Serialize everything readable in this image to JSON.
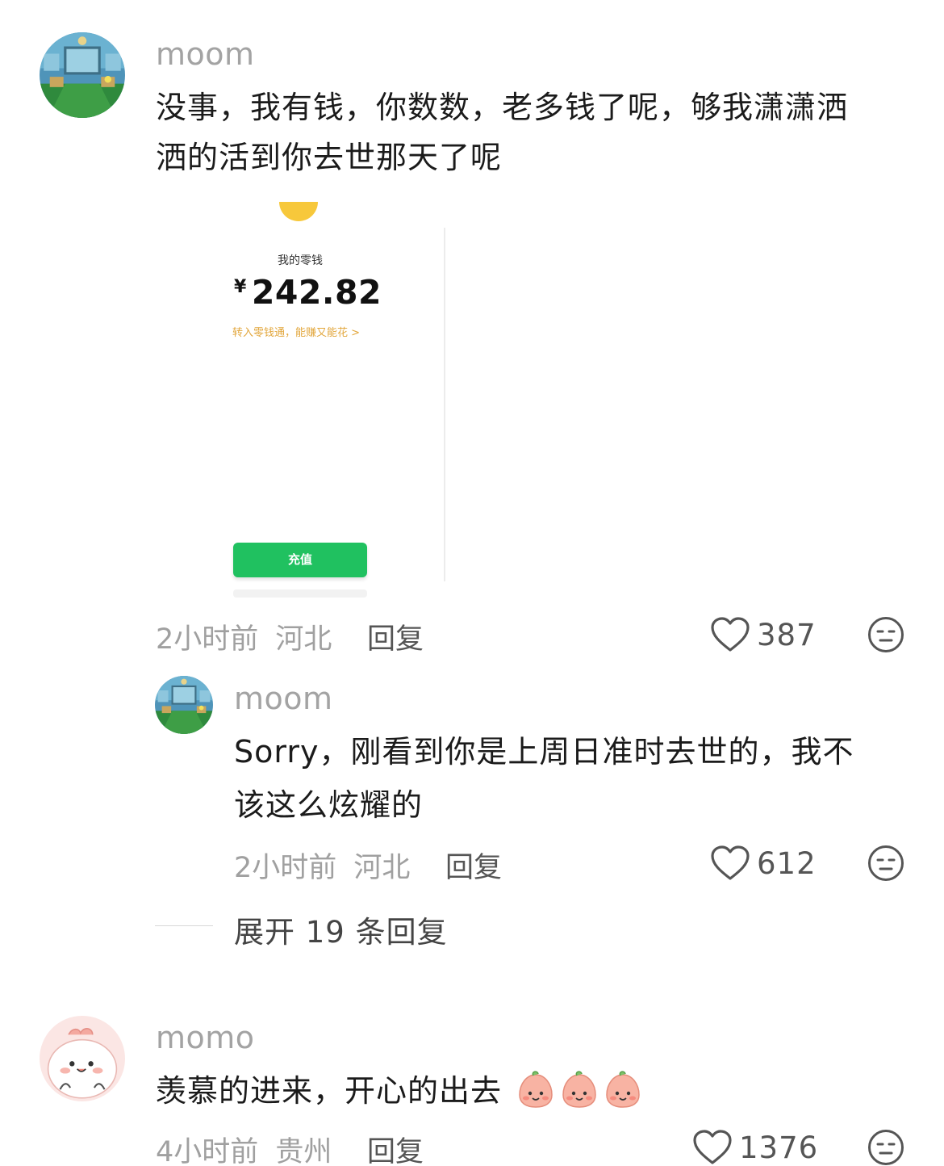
{
  "comments": [
    {
      "username": "moom",
      "text_line1": "没事，我有钱，你数数，老多钱了呢，够我潇潇洒",
      "text_line2": "洒的活到你去世那天了呢",
      "time": "2小时前",
      "location": "河北",
      "reply_label": "回复",
      "likes": "387"
    },
    {
      "username": "moom",
      "text_line1": "Sorry，刚看到你是上周日准时去世的，我不",
      "text_line2": "该这么炫耀的",
      "time": "2小时前",
      "location": "河北",
      "reply_label": "回复",
      "likes": "612"
    },
    {
      "username": "momo",
      "text": "羡慕的进来，开心的出去",
      "time": "4小时前",
      "location": "贵州",
      "reply_label": "回复",
      "likes": "1376"
    }
  ],
  "embedded_screenshot": {
    "label": "我的零钱",
    "currency": "¥",
    "amount": "242.82",
    "promo": "转入零钱通，能赚又能花 >",
    "button": "充值",
    "accent": "#20c160"
  },
  "expand_replies": "展开 19 条回复",
  "colors": {
    "like_icon": "#555555",
    "secondary_text": "#a0a0a0"
  }
}
